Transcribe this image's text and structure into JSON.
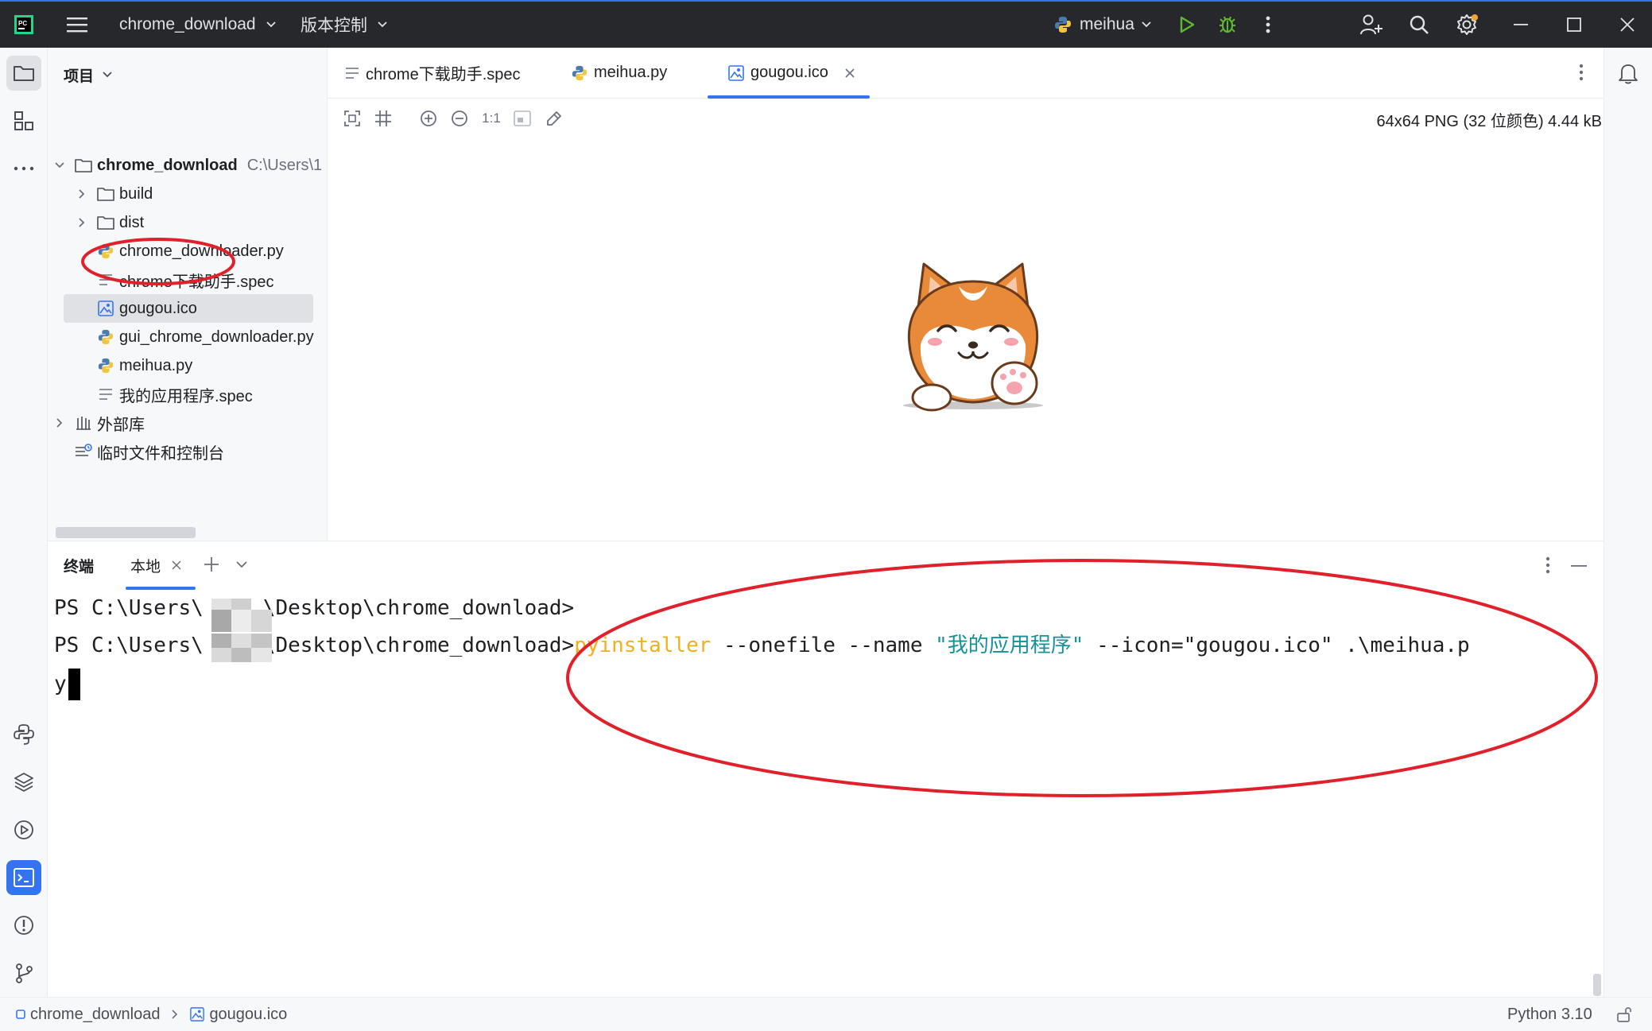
{
  "titlebar": {
    "project_name": "chrome_download",
    "vcs_label": "版本控制",
    "run_config": "meihua"
  },
  "project_panel": {
    "title": "项目",
    "root": {
      "name": "chrome_download",
      "path": "C:\\Users\\1"
    },
    "items": [
      {
        "label": "build",
        "type": "folder"
      },
      {
        "label": "dist",
        "type": "folder"
      },
      {
        "label": "chrome_downloader.py",
        "type": "python"
      },
      {
        "label": "chrome下载助手.spec",
        "type": "text"
      },
      {
        "label": "gougou.ico",
        "type": "image",
        "selected": true
      },
      {
        "label": "gui_chrome_downloader.py",
        "type": "python"
      },
      {
        "label": "meihua.py",
        "type": "python"
      },
      {
        "label": "我的应用程序.spec",
        "type": "text"
      }
    ],
    "external_libs": "外部库",
    "scratches": "临时文件和控制台"
  },
  "editor": {
    "tabs": [
      {
        "label": "chrome下载助手.spec",
        "icon": "text-file-icon"
      },
      {
        "label": "meihua.py",
        "icon": "python-icon"
      },
      {
        "label": "gougou.ico",
        "icon": "image-file-icon",
        "active": true
      }
    ],
    "image_toolbar": {
      "zoom_actual": "1:1"
    },
    "image_info": "64x64 PNG (32 位颜色) 4.44 kB"
  },
  "terminal": {
    "title": "终端",
    "tab_label": "本地",
    "prompt_prefix": "PS C:\\Users\\",
    "prompt_suffix": "\\Desktop\\chrome_download>",
    "line1_cmd": "",
    "line2_cmd_name": "pyinstaller",
    "line2_args1": " --onefile --name ",
    "line2_str": "\"我的应用程序\"",
    "line2_args2": " --icon=\"gougou.ico\" .\\meihua.p",
    "line3": "y"
  },
  "statusbar": {
    "breadcrumb_root": "chrome_download",
    "breadcrumb_file": "gougou.ico",
    "interpreter": "Python 3.10"
  },
  "colors": {
    "accent": "#3574f0",
    "annotation_red": "#e0202a",
    "titlebar_bg": "#27282c",
    "run_green": "#5fb832"
  }
}
